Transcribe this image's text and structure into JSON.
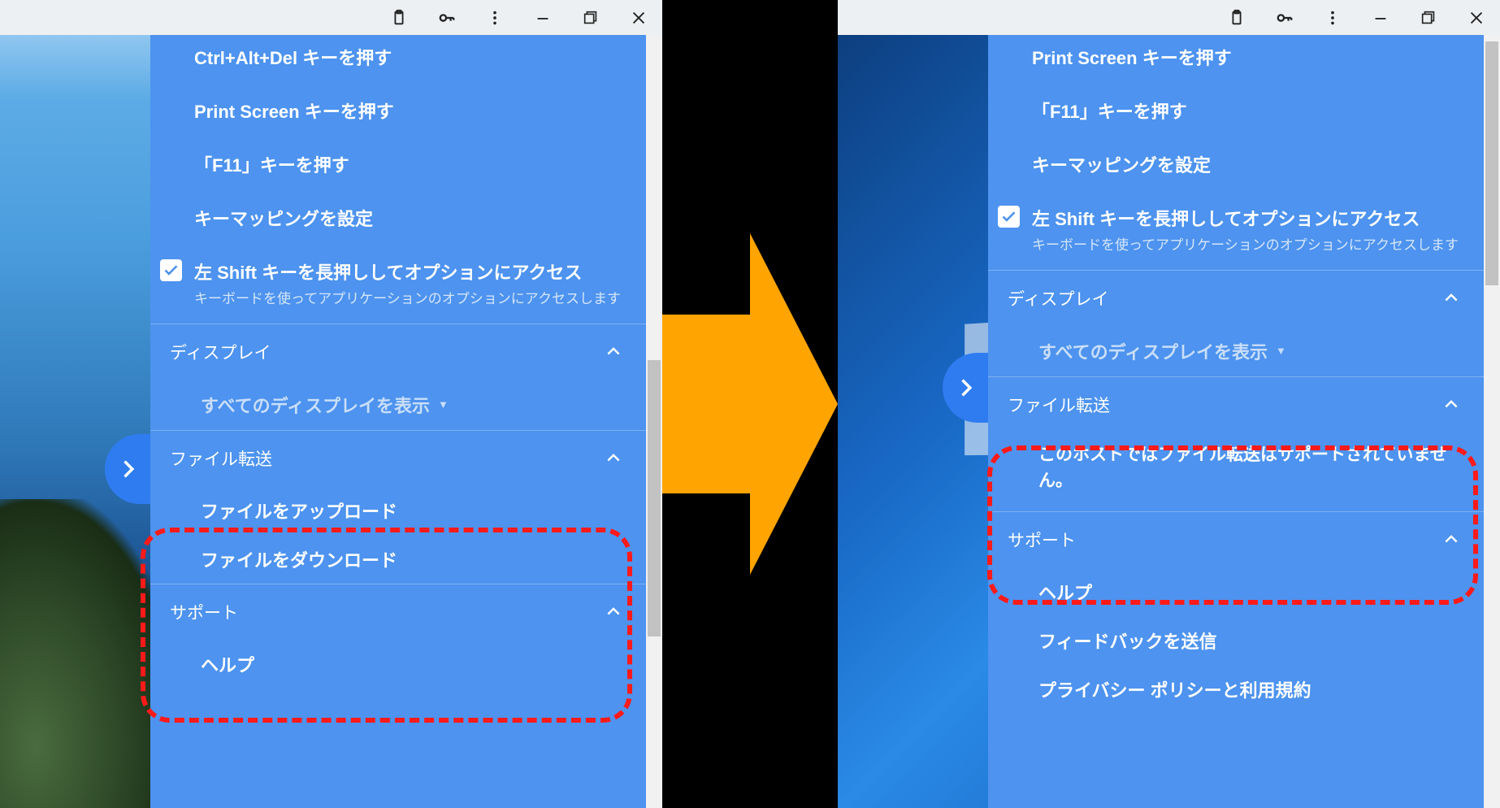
{
  "left": {
    "items": {
      "ctrl_alt_del": "Ctrl+Alt+Del キーを押す",
      "print_screen": "Print Screen キーを押す",
      "f11": "「F11」キーを押す",
      "key_mapping": "キーマッピングを設定",
      "shift_opt": "左 Shift キーを長押ししてオプションにアクセス",
      "shift_opt_sub": "キーボードを使ってアプリケーションのオプションにアクセスします"
    },
    "display": {
      "head": "ディスプレイ",
      "all": "すべてのディスプレイを表示"
    },
    "file": {
      "head": "ファイル転送",
      "upload": "ファイルをアップロード",
      "download": "ファイルをダウンロード"
    },
    "support": {
      "head": "サポート",
      "help": "ヘルプ"
    }
  },
  "right": {
    "items": {
      "print_screen": "Print Screen キーを押す",
      "f11": "「F11」キーを押す",
      "key_mapping": "キーマッピングを設定",
      "shift_opt": "左 Shift キーを長押ししてオプションにアクセス",
      "shift_opt_sub": "キーボードを使ってアプリケーションのオプションにアクセスします"
    },
    "display": {
      "head": "ディスプレイ",
      "all": "すべてのディスプレイを表示"
    },
    "file": {
      "head": "ファイル転送",
      "msg": "このホストではファイル転送はサポートされていません。"
    },
    "support": {
      "head": "サポート",
      "help": "ヘルプ",
      "feedback": "フィードバックを送信",
      "privacy": "プライバシー ポリシーと利用規約"
    }
  }
}
